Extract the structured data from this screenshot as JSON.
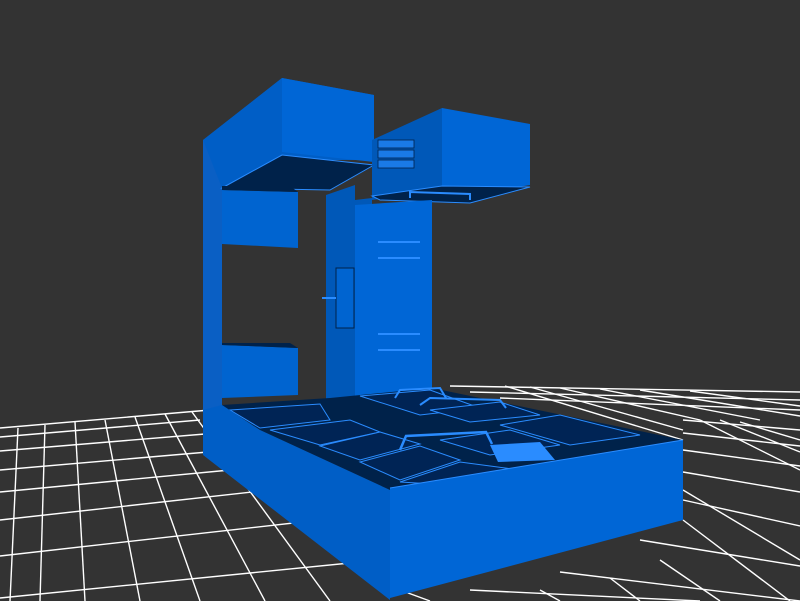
{
  "viewport": {
    "background": "#333333",
    "grid_color": "#ffffff",
    "model_color": "#0066cc",
    "model_dark": "#00224a",
    "model_highlight": "#2a8cff"
  },
  "scene": {
    "object": "kitchen-cabinet-unit-3d-model",
    "floor": "wireframe-grid"
  }
}
